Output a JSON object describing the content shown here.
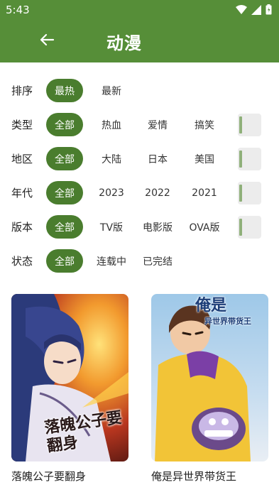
{
  "status": {
    "time": "5:43"
  },
  "header": {
    "title": "动漫"
  },
  "filters": {
    "sort": {
      "label": "排序",
      "options": [
        "最热",
        "最新"
      ]
    },
    "type": {
      "label": "类型",
      "options": [
        "全部",
        "热血",
        "爱情",
        "搞笑"
      ]
    },
    "region": {
      "label": "地区",
      "options": [
        "全部",
        "大陆",
        "日本",
        "美国"
      ]
    },
    "year": {
      "label": "年代",
      "options": [
        "全部",
        "2023",
        "2022",
        "2021"
      ]
    },
    "version": {
      "label": "版本",
      "options": [
        "全部",
        "TV版",
        "电影版",
        "OVA版"
      ]
    },
    "state": {
      "label": "状态",
      "options": [
        "全部",
        "连载中",
        "已完结"
      ]
    }
  },
  "items": [
    {
      "title": "落魄公子要翻身",
      "cover_text": "落魄公子要翻身"
    },
    {
      "title": "俺是异世界带货王",
      "cover_text_main": "俺是",
      "cover_text_sub": "异世界带货王"
    }
  ],
  "colors": {
    "accent": "#568e38",
    "chip_active": "#4a7d2e"
  }
}
